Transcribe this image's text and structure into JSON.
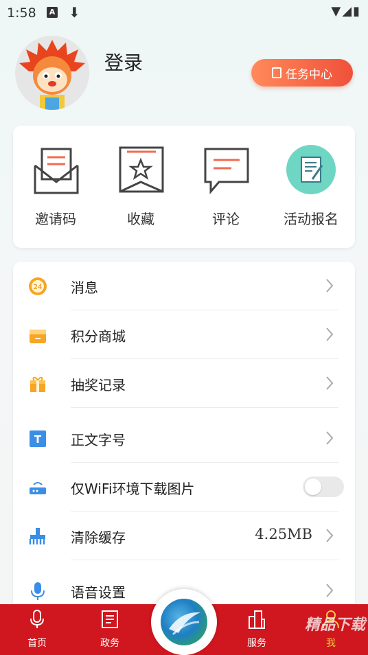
{
  "status_bar": {
    "time": "1:58",
    "a_badge": "A"
  },
  "profile": {
    "login_label": "登录",
    "task_center_label": "任务中心"
  },
  "quick_actions": [
    {
      "label": "邀请码",
      "icon": "invite-envelope-icon"
    },
    {
      "label": "收藏",
      "icon": "bookmark-star-icon"
    },
    {
      "label": "评论",
      "icon": "comment-bubble-icon"
    },
    {
      "label": "活动报名",
      "icon": "activity-signup-icon"
    }
  ],
  "menu": [
    {
      "label": "消息",
      "icon": "message-24-icon",
      "value": "",
      "badge": "24"
    },
    {
      "label": "积分商城",
      "icon": "shop-box-icon",
      "value": ""
    },
    {
      "label": "抽奖记录",
      "icon": "gift-icon",
      "value": ""
    },
    {
      "label": "正文字号",
      "icon": "font-size-icon",
      "value": "",
      "badge": "T"
    },
    {
      "label": "仅WiFi环境下载图片",
      "icon": "router-icon",
      "value": "",
      "toggle": false
    },
    {
      "label": "清除缓存",
      "icon": "broom-icon",
      "value": "4.25MB"
    },
    {
      "label": "语音设置",
      "icon": "microphone-icon",
      "value": ""
    }
  ],
  "tabbar": [
    {
      "label": "首页",
      "icon": "microphone-tab-icon"
    },
    {
      "label": "政务",
      "icon": "document-tab-icon"
    },
    {
      "label": "服务",
      "icon": "buildings-tab-icon"
    },
    {
      "label": "我",
      "icon": "person-tab-icon"
    }
  ],
  "watermark": "精品下载",
  "colors": {
    "accent_red": "#d0161e",
    "task_orange": "#f0503a",
    "quick_icon_red": "#f26b4f",
    "teal": "#6fd6c4"
  }
}
